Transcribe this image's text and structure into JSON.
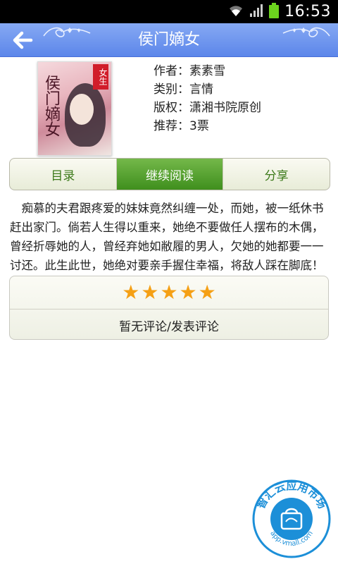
{
  "statusbar": {
    "time": "16:53"
  },
  "titlebar": {
    "title": "侯门嫡女"
  },
  "book": {
    "cover_tag": "女生",
    "cover_title": "侯门嫡女",
    "author": "作者：素素雪",
    "category": "类别：言情",
    "copyright": "版权：潇湘书院原创",
    "recommend": "推荐：3票"
  },
  "tabs": [
    {
      "label": "目录",
      "active": false
    },
    {
      "label": "继续阅读",
      "active": true
    },
    {
      "label": "分享",
      "active": false
    }
  ],
  "description": "痴慕的夫君跟疼爱的妹妹竟然纠缠一处，而她，被一纸休书赶出家门。倘若人生得以重来，她绝不要做任人摆布的木偶，曾经折辱她的人，曾经弃她如敝履的男人，欠她的她都要一一讨还。此生此世，她绝对要亲手握住幸福，将敌人踩在脚底！",
  "review": {
    "stars": [
      "★",
      "★",
      "★",
      "★",
      "★"
    ],
    "rating": 5,
    "link_label": "暂无评论/发表评论"
  },
  "badge": {
    "text": "智汇云应用市场",
    "url": "app.vmall.com"
  },
  "colors": {
    "titlebar": "#6b93ee",
    "tab_active": "#4f9f28",
    "star": "#f5a015",
    "badge": "#1c8fd8"
  }
}
